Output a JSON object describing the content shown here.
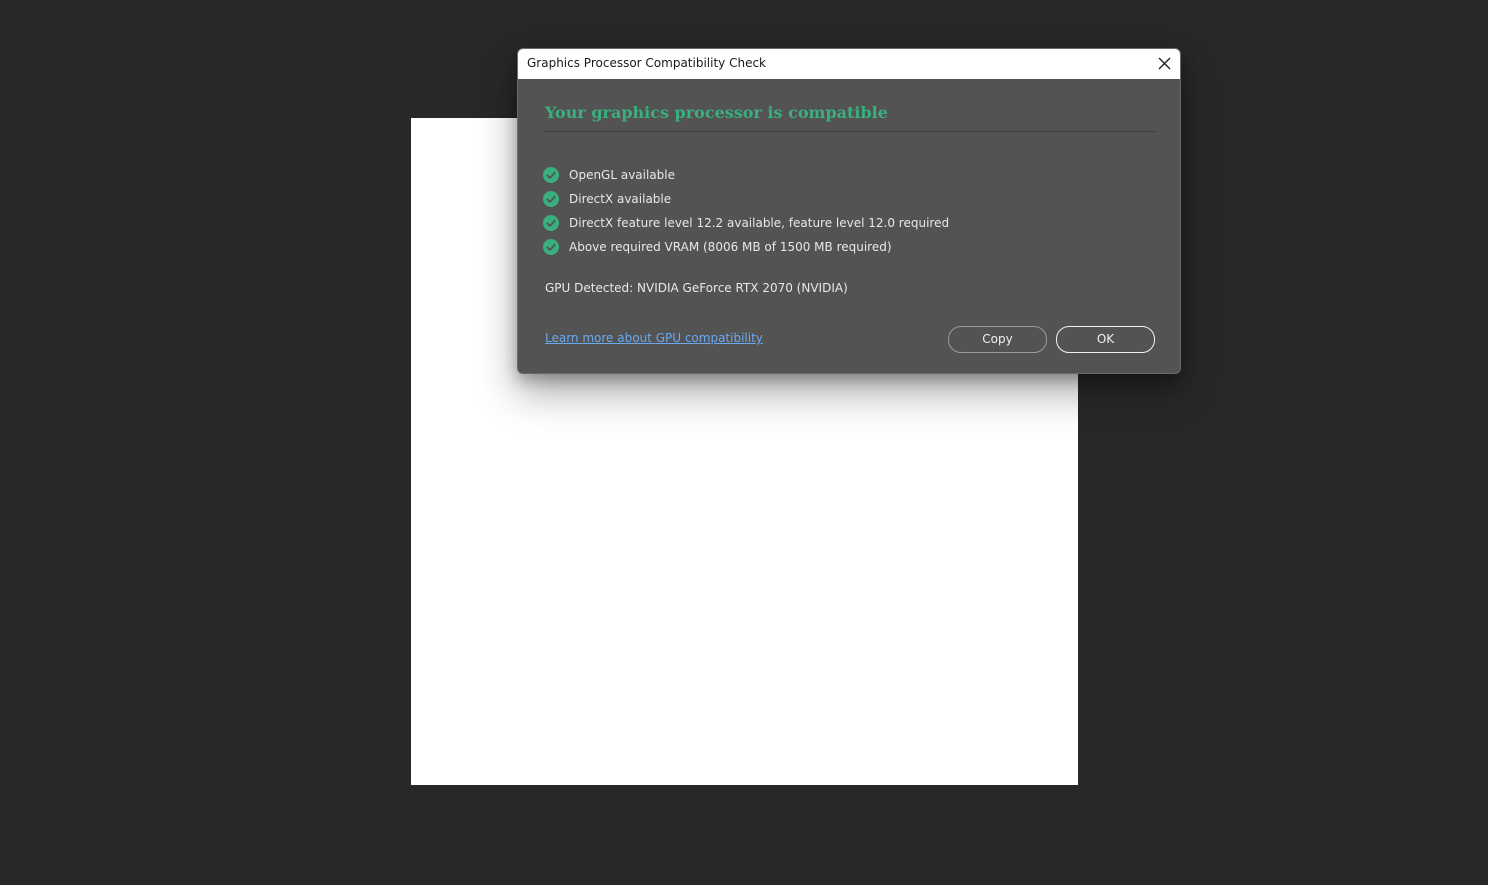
{
  "dialog": {
    "title": "Graphics Processor Compatibility Check",
    "heading": "Your graphics processor is compatible",
    "checks": [
      {
        "label": "OpenGL available",
        "status": "pass"
      },
      {
        "label": "DirectX available",
        "status": "pass"
      },
      {
        "label": "DirectX feature level 12.2 available, feature level 12.0 required",
        "status": "pass"
      },
      {
        "label": "Above required VRAM (8006 MB of 1500 MB required)",
        "status": "pass"
      }
    ],
    "gpu_detected": "GPU Detected: NVIDIA GeForce RTX 2070 (NVIDIA)",
    "learn_more_link": "Learn more about GPU compatibility",
    "copy_label": "Copy",
    "ok_label": "OK"
  },
  "colors": {
    "background": "#282828",
    "dialog_body": "#535353",
    "accent_green": "#3ab07f",
    "link_blue": "#6aa9f0"
  },
  "icons": {
    "close": "close-icon",
    "check": "check-circle-icon"
  }
}
